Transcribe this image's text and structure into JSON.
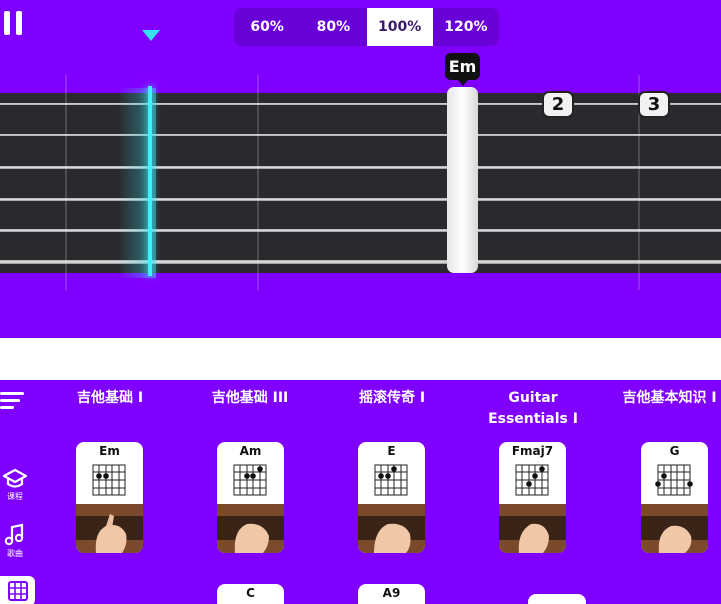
{
  "player": {
    "speeds": [
      {
        "label": "60%"
      },
      {
        "label": "80%"
      },
      {
        "label": "100%"
      },
      {
        "label": "120%"
      }
    ],
    "active_speed": "100%",
    "current_chord": "Em",
    "fret_markers": [
      "2",
      "3"
    ]
  },
  "courses": [
    {
      "title": "吉他基础 I",
      "chord": "Em"
    },
    {
      "title": "吉他基础 III",
      "chord": "Am"
    },
    {
      "title": "摇滚传奇 I",
      "chord": "E"
    },
    {
      "title": "Guitar Essentials I",
      "chord": "Fmaj7"
    },
    {
      "title": "吉他基本知识 I",
      "chord": "G"
    }
  ],
  "second_row": [
    {
      "chord": "C"
    },
    {
      "chord": "A9"
    },
    {
      "chord": ""
    }
  ],
  "sidebar": {
    "items": [
      {
        "label": "课程",
        "icon": "graduation-cap-icon"
      },
      {
        "label": "歌曲",
        "icon": "music-note-icon"
      },
      {
        "label": "",
        "icon": "chord-grid-icon"
      }
    ]
  },
  "colors": {
    "background": "#8000ff",
    "playhead": "#3ff0ff",
    "speed_bar": "#6a00d8"
  }
}
